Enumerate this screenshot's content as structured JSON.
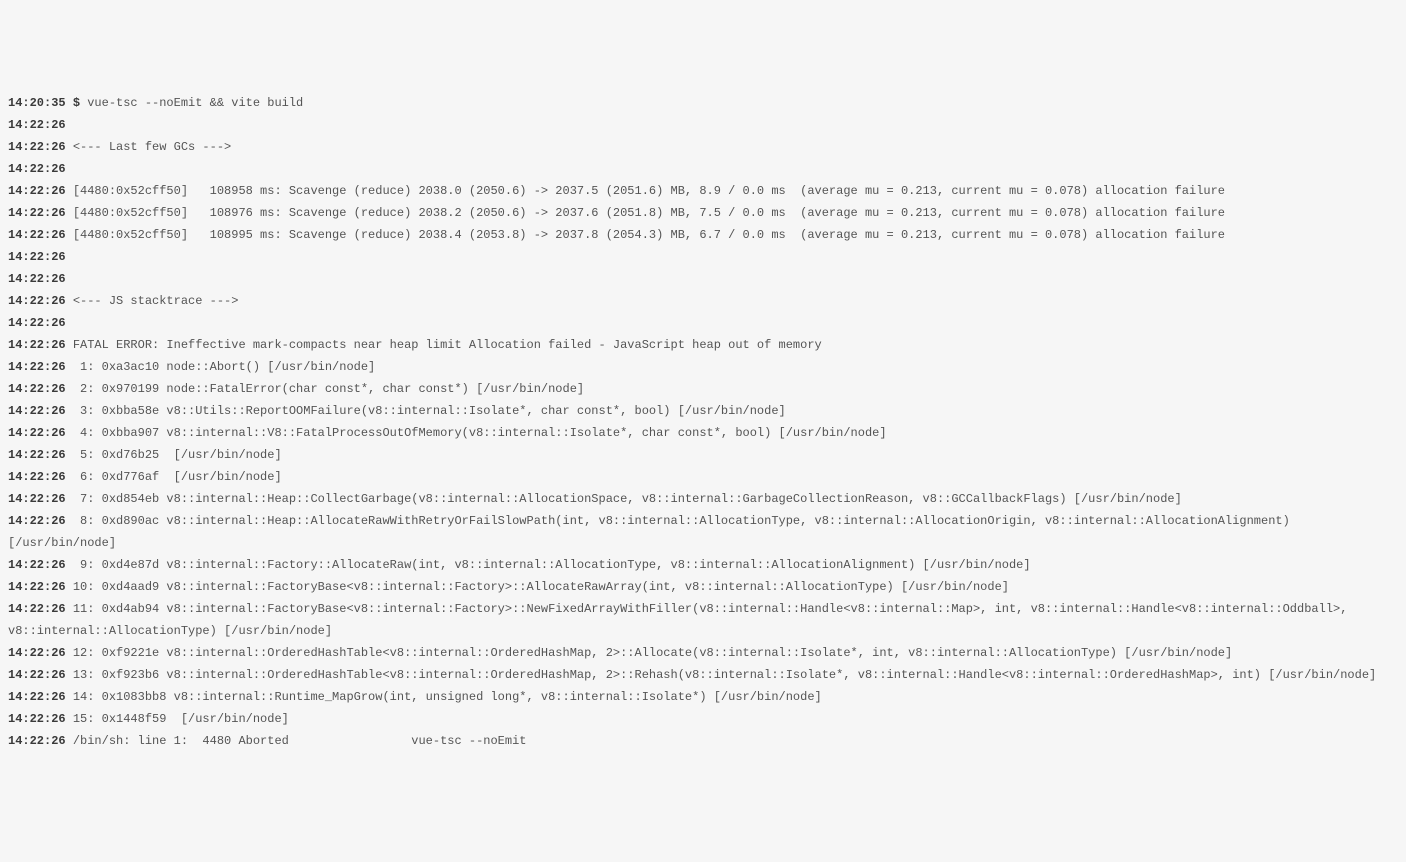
{
  "lines": [
    {
      "ts": "14:20:35",
      "prompt": "$",
      "text": "vue-tsc --noEmit && vite build"
    },
    {
      "ts": "14:22:26",
      "text": ""
    },
    {
      "ts": "14:22:26",
      "text": "<--- Last few GCs --->"
    },
    {
      "ts": "14:22:26",
      "text": ""
    },
    {
      "ts": "14:22:26",
      "text": "[4480:0x52cff50]   108958 ms: Scavenge (reduce) 2038.0 (2050.6) -> 2037.5 (2051.6) MB, 8.9 / 0.0 ms  (average mu = 0.213, current mu = 0.078) allocation failure"
    },
    {
      "ts": "14:22:26",
      "text": "[4480:0x52cff50]   108976 ms: Scavenge (reduce) 2038.2 (2050.6) -> 2037.6 (2051.8) MB, 7.5 / 0.0 ms  (average mu = 0.213, current mu = 0.078) allocation failure"
    },
    {
      "ts": "14:22:26",
      "text": "[4480:0x52cff50]   108995 ms: Scavenge (reduce) 2038.4 (2053.8) -> 2037.8 (2054.3) MB, 6.7 / 0.0 ms  (average mu = 0.213, current mu = 0.078) allocation failure"
    },
    {
      "ts": "14:22:26",
      "text": ""
    },
    {
      "ts": "14:22:26",
      "text": ""
    },
    {
      "ts": "14:22:26",
      "text": "<--- JS stacktrace --->"
    },
    {
      "ts": "14:22:26",
      "text": ""
    },
    {
      "ts": "14:22:26",
      "text": "FATAL ERROR: Ineffective mark-compacts near heap limit Allocation failed - JavaScript heap out of memory"
    },
    {
      "ts": "14:22:26",
      "text": " 1: 0xa3ac10 node::Abort() [/usr/bin/node]"
    },
    {
      "ts": "14:22:26",
      "text": " 2: 0x970199 node::FatalError(char const*, char const*) [/usr/bin/node]"
    },
    {
      "ts": "14:22:26",
      "text": " 3: 0xbba58e v8::Utils::ReportOOMFailure(v8::internal::Isolate*, char const*, bool) [/usr/bin/node]"
    },
    {
      "ts": "14:22:26",
      "text": " 4: 0xbba907 v8::internal::V8::FatalProcessOutOfMemory(v8::internal::Isolate*, char const*, bool) [/usr/bin/node]"
    },
    {
      "ts": "14:22:26",
      "text": " 5: 0xd76b25  [/usr/bin/node]"
    },
    {
      "ts": "14:22:26",
      "text": " 6: 0xd776af  [/usr/bin/node]"
    },
    {
      "ts": "14:22:26",
      "text": " 7: 0xd854eb v8::internal::Heap::CollectGarbage(v8::internal::AllocationSpace, v8::internal::GarbageCollectionReason, v8::GCCallbackFlags) [/usr/bin/node]"
    },
    {
      "ts": "14:22:26",
      "text": " 8: 0xd890ac v8::internal::Heap::AllocateRawWithRetryOrFailSlowPath(int, v8::internal::AllocationType, v8::internal::AllocationOrigin, v8::internal::AllocationAlignment) [/usr/bin/node]"
    },
    {
      "ts": "14:22:26",
      "text": " 9: 0xd4e87d v8::internal::Factory::AllocateRaw(int, v8::internal::AllocationType, v8::internal::AllocationAlignment) [/usr/bin/node]"
    },
    {
      "ts": "14:22:26",
      "text": "10: 0xd4aad9 v8::internal::FactoryBase<v8::internal::Factory>::AllocateRawArray(int, v8::internal::AllocationType) [/usr/bin/node]"
    },
    {
      "ts": "14:22:26",
      "text": "11: 0xd4ab94 v8::internal::FactoryBase<v8::internal::Factory>::NewFixedArrayWithFiller(v8::internal::Handle<v8::internal::Map>, int, v8::internal::Handle<v8::internal::Oddball>, v8::internal::AllocationType) [/usr/bin/node]"
    },
    {
      "ts": "14:22:26",
      "text": "12: 0xf9221e v8::internal::OrderedHashTable<v8::internal::OrderedHashMap, 2>::Allocate(v8::internal::Isolate*, int, v8::internal::AllocationType) [/usr/bin/node]"
    },
    {
      "ts": "14:22:26",
      "text": "13: 0xf923b6 v8::internal::OrderedHashTable<v8::internal::OrderedHashMap, 2>::Rehash(v8::internal::Isolate*, v8::internal::Handle<v8::internal::OrderedHashMap>, int) [/usr/bin/node]"
    },
    {
      "ts": "14:22:26",
      "text": "14: 0x1083bb8 v8::internal::Runtime_MapGrow(int, unsigned long*, v8::internal::Isolate*) [/usr/bin/node]"
    },
    {
      "ts": "14:22:26",
      "text": "15: 0x1448f59  [/usr/bin/node]"
    },
    {
      "ts": "14:22:26",
      "text": "/bin/sh: line 1:  4480 Aborted                 vue-tsc --noEmit"
    }
  ]
}
